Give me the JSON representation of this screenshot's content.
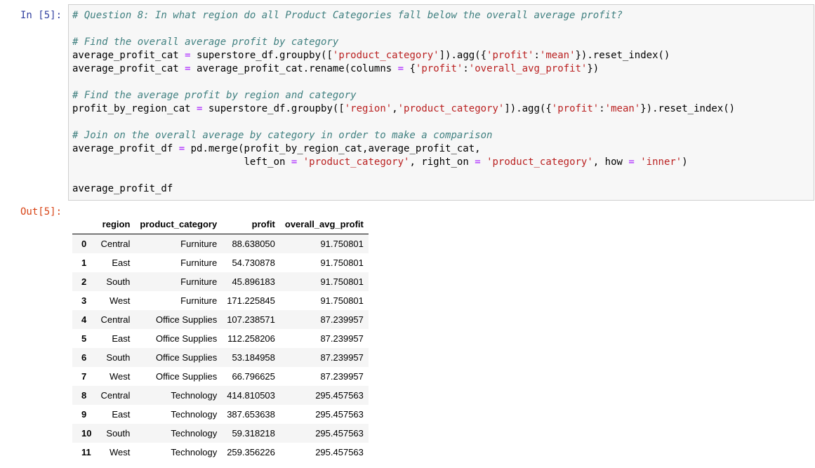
{
  "cell": {
    "in_prompt": "In [5]:",
    "out_prompt": "Out[5]:",
    "code": {
      "line1_comment": "# Question 8: In what region do all Product Categories fall below the overall average profit?",
      "line2_comment": "# Find the overall average profit by category",
      "line3": {
        "a": "average_profit_cat ",
        "op": "=",
        "b": " superstore_df.groupby([",
        "s1": "'product_category'",
        "c": "]).agg({",
        "s2": "'profit'",
        "d": ":",
        "s3": "'mean'",
        "e": "}).reset_index()"
      },
      "line4": {
        "a": "average_profit_cat ",
        "op": "=",
        "b": " average_profit_cat.rename(columns ",
        "op2": "=",
        "c": " {",
        "s1": "'profit'",
        "d": ":",
        "s2": "'overall_avg_profit'",
        "e": "})"
      },
      "line5_comment": "# Find the average profit by region and category",
      "line6": {
        "a": "profit_by_region_cat ",
        "op": "=",
        "b": " superstore_df.groupby([",
        "s1": "'region'",
        "c": ",",
        "s2": "'product_category'",
        "d": "]).agg({",
        "s3": "'profit'",
        "e": ":",
        "s4": "'mean'",
        "f": "}).reset_index()"
      },
      "line7_comment": "# Join on the overall average by category in order to make a comparison",
      "line8": {
        "a": "average_profit_df ",
        "op": "=",
        "b": " pd.merge(profit_by_region_cat,average_profit_cat,"
      },
      "line9": {
        "indent": "                             ",
        "a": "left_on ",
        "op": "=",
        "b": " ",
        "s1": "'product_category'",
        "c": ", right_on ",
        "op2": "=",
        "d": " ",
        "s2": "'product_category'",
        "e": ", how ",
        "op3": "=",
        "f": " ",
        "s3": "'inner'",
        "g": ")"
      },
      "line10": "average_profit_df"
    }
  },
  "output_table": {
    "columns": [
      "",
      "region",
      "product_category",
      "profit",
      "overall_avg_profit"
    ],
    "rows": [
      [
        "0",
        "Central",
        "Furniture",
        "88.638050",
        "91.750801"
      ],
      [
        "1",
        "East",
        "Furniture",
        "54.730878",
        "91.750801"
      ],
      [
        "2",
        "South",
        "Furniture",
        "45.896183",
        "91.750801"
      ],
      [
        "3",
        "West",
        "Furniture",
        "171.225845",
        "91.750801"
      ],
      [
        "4",
        "Central",
        "Office Supplies",
        "107.238571",
        "87.239957"
      ],
      [
        "5",
        "East",
        "Office Supplies",
        "112.258206",
        "87.239957"
      ],
      [
        "6",
        "South",
        "Office Supplies",
        "53.184958",
        "87.239957"
      ],
      [
        "7",
        "West",
        "Office Supplies",
        "66.796625",
        "87.239957"
      ],
      [
        "8",
        "Central",
        "Technology",
        "414.810503",
        "295.457563"
      ],
      [
        "9",
        "East",
        "Technology",
        "387.653638",
        "295.457563"
      ],
      [
        "10",
        "South",
        "Technology",
        "59.318218",
        "295.457563"
      ],
      [
        "11",
        "West",
        "Technology",
        "259.356226",
        "295.457563"
      ]
    ]
  },
  "colors": {
    "in_prompt": "#303f9f",
    "out_prompt": "#d84315",
    "comment": "#408080",
    "string": "#ba2121",
    "operator": "#aa22ff",
    "input_bg": "#f7f7f7",
    "input_border": "#cfcfcf"
  }
}
